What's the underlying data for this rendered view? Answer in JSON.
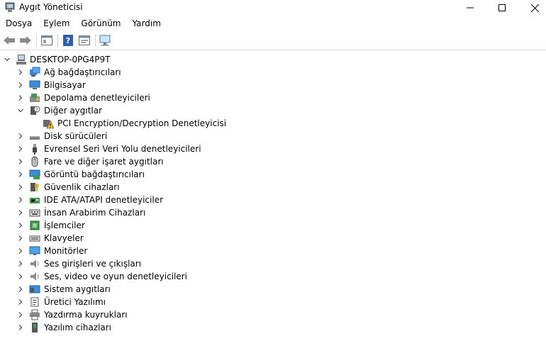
{
  "window": {
    "title": "Aygıt Yöneticisi",
    "minimize_icon": "minimize-icon",
    "maximize_icon": "maximize-icon",
    "close_icon": "close-icon"
  },
  "menu": [
    "Dosya",
    "Eylem",
    "Görünüm",
    "Yardım"
  ],
  "toolbar": [
    "back-arrow-icon",
    "forward-arrow-icon",
    "properties-icon",
    "help-icon",
    "update-driver-icon",
    "monitor-scan-icon"
  ],
  "tree": {
    "root": "DESKTOP-0PG4P9T",
    "categories": [
      {
        "label": "Ağ bağdaştırıcıları",
        "icon": "network-adapter-icon",
        "expanded": false
      },
      {
        "label": "Bilgisayar",
        "icon": "computer-icon",
        "expanded": false
      },
      {
        "label": "Depolama denetleyicileri",
        "icon": "storage-controller-icon",
        "expanded": false
      },
      {
        "label": "Diğer aygıtlar",
        "icon": "other-devices-icon",
        "expanded": true,
        "children": [
          {
            "label": "PCI Encryption/Decryption Denetleyicisi",
            "icon": "warning-device-icon"
          }
        ]
      },
      {
        "label": "Disk sürücüleri",
        "icon": "disk-drive-icon",
        "expanded": false
      },
      {
        "label": "Evrensel Seri Veri Yolu denetleyicileri",
        "icon": "usb-icon",
        "expanded": false
      },
      {
        "label": "Fare ve diğer işaret aygıtları",
        "icon": "mouse-icon",
        "expanded": false
      },
      {
        "label": "Görüntü bağdaştırıcıları",
        "icon": "display-adapter-icon",
        "expanded": false
      },
      {
        "label": "Güvenlik cihazları",
        "icon": "security-device-icon",
        "expanded": false
      },
      {
        "label": "IDE ATA/ATAPI denetleyiciler",
        "icon": "ide-controller-icon",
        "expanded": false
      },
      {
        "label": "İnsan Arabirim Cihazları",
        "icon": "hid-icon",
        "expanded": false
      },
      {
        "label": "İşlemciler",
        "icon": "processor-icon",
        "expanded": false
      },
      {
        "label": "Klavyeler",
        "icon": "keyboard-icon",
        "expanded": false
      },
      {
        "label": "Monitörler",
        "icon": "monitor-icon",
        "expanded": false
      },
      {
        "label": "Ses girişleri ve çıkışları",
        "icon": "audio-io-icon",
        "expanded": false
      },
      {
        "label": "Ses, video ve oyun denetleyicileri",
        "icon": "sound-video-icon",
        "expanded": false
      },
      {
        "label": "Sistem aygıtları",
        "icon": "system-devices-icon",
        "expanded": false
      },
      {
        "label": "Üretici Yazılımı",
        "icon": "firmware-icon",
        "expanded": false
      },
      {
        "label": "Yazdırma kuyrukları",
        "icon": "print-queue-icon",
        "expanded": false
      },
      {
        "label": "Yazılım cihazları",
        "icon": "software-device-icon",
        "expanded": false
      }
    ]
  }
}
